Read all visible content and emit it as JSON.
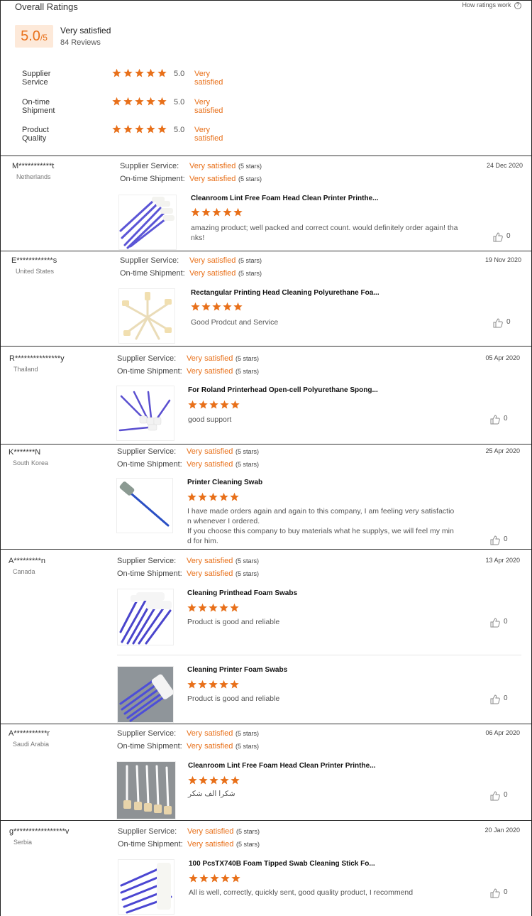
{
  "summary": {
    "title": "Overall Ratings",
    "how_link": "How ratings work",
    "help_icon": "?",
    "score": "5.0",
    "score_denominator": "/5",
    "score_text": "Very satisfied",
    "review_count": "84 Reviews",
    "metrics": [
      {
        "label": "Supplier Service",
        "value": "5.0",
        "word": "Very satisfied",
        "stars": 5
      },
      {
        "label": "On-time Shipment",
        "value": "5.0",
        "word": "Very satisfied",
        "stars": 5
      },
      {
        "label": "Product Quality",
        "value": "5.0",
        "word": "Very satisfied",
        "stars": 5
      }
    ]
  },
  "labels": {
    "supplier_service": "Supplier Service:",
    "ontime_shipment": "On-time Shipment:",
    "very_satisfied": "Very satisfied",
    "five_stars": "(5 stars)"
  },
  "colors": {
    "accent": "#e8701a",
    "score_bg": "#fde9d9"
  },
  "reviews": [
    {
      "name": "M***********t",
      "country": "Netherlands",
      "date": "24 Dec 2020",
      "products": [
        {
          "title": "Cleanroom Lint Free Foam Head Clean Printer Printhe...",
          "rating": 5,
          "comment": [
            "amazing product; well packed and correct count. would definitely order again! tha",
            "nks!"
          ],
          "likes": "0"
        }
      ]
    },
    {
      "name": "E************s",
      "country": "United States",
      "date": "19 Nov 2020",
      "products": [
        {
          "title": "Rectangular Printing Head Cleaning Polyurethane Foa...",
          "rating": 5,
          "comment": [
            "Good Prodcut and Service"
          ],
          "likes": "0"
        }
      ]
    },
    {
      "name": "R***************y",
      "country": "Thailand",
      "date": "05 Apr 2020",
      "products": [
        {
          "title": "For Roland Printerhead Open-cell Polyurethane Spong...",
          "rating": 5,
          "comment": [
            "good support"
          ],
          "likes": "0"
        }
      ]
    },
    {
      "name": "K*******N",
      "country": "South Korea",
      "date": "25 Apr 2020",
      "products": [
        {
          "title": "Printer Cleaning Swab",
          "rating": 5,
          "comment": [
            "I have made orders again and again to this company, I am feeling very satisfactio",
            "n whenever I ordered.",
            "If you choose this company to buy materials what he supplys, we will feel my min",
            "d for him."
          ],
          "likes": "0"
        }
      ]
    },
    {
      "name": "A*********n",
      "country": "Canada",
      "date": "13 Apr 2020",
      "products": [
        {
          "title": "Cleaning Printhead Foam Swabs",
          "rating": 5,
          "comment": [
            "Product is good and reliable"
          ],
          "likes": "0"
        },
        {
          "title": "Cleaning Printer Foam Swabs",
          "rating": 5,
          "comment": [
            "Product is good and reliable"
          ],
          "likes": "0"
        }
      ]
    },
    {
      "name": "A***********r",
      "country": "Saudi Arabia",
      "date": "06 Apr 2020",
      "products": [
        {
          "title": "Cleanroom Lint Free Foam Head Clean Printer Printhe...",
          "rating": 5,
          "comment": [
            "شكرا الف شكر"
          ],
          "likes": "0"
        }
      ]
    },
    {
      "name": "g*****************v",
      "country": "Serbia",
      "date": "20 Jan 2020",
      "products": [
        {
          "title": "100 PcsTX740B Foam Tipped Swab Cleaning Stick Fo...",
          "rating": 5,
          "comment": [
            "All is well, correctly, quickly sent, good quality product, I recommend"
          ],
          "likes": "0"
        }
      ]
    }
  ]
}
